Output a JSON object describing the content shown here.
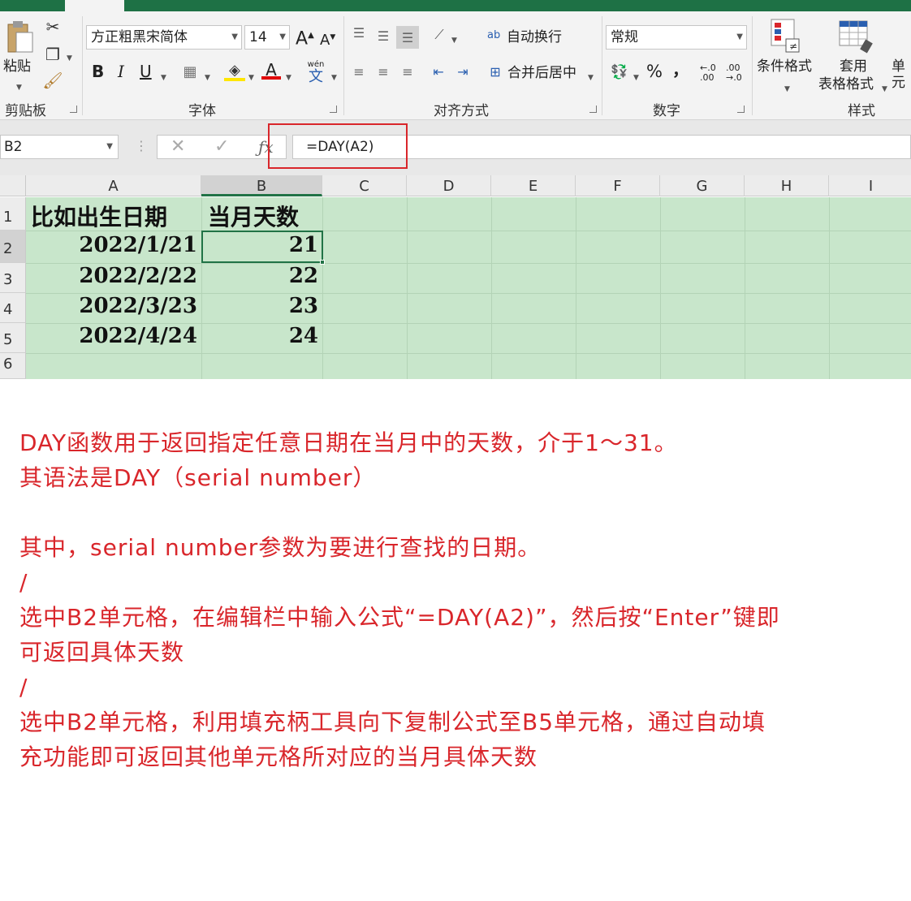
{
  "ribbon": {
    "clipboard": {
      "paste_label": "粘贴",
      "group_label": "剪贴板"
    },
    "font": {
      "font_name": "方正粗黑宋简体",
      "font_size": "14",
      "bold": "B",
      "italic": "I",
      "underline": "U",
      "grow": "A",
      "shrink": "A",
      "font_color": "A",
      "phonetic": "wén",
      "phonetic_char": "文",
      "group_label": "字体"
    },
    "alignment": {
      "wrap_text": "自动换行",
      "merge_center": "合并后居中",
      "wrap_icon_text": "ab",
      "group_label": "对齐方式"
    },
    "number": {
      "format": "常规",
      "percent": "%",
      "comma": "，",
      "inc_decimal": "←.0 .00",
      "dec_decimal": ".00 →.0",
      "group_label": "数字"
    },
    "styles": {
      "conditional": "条件格式",
      "table_format_line1": "套用",
      "table_format_line2": "表格格式",
      "cell_styles": "单元",
      "group_label": "样式"
    }
  },
  "formula_bar": {
    "name_box": "B2",
    "formula": "=DAY(A2)"
  },
  "grid": {
    "columns": [
      "A",
      "B",
      "C",
      "D",
      "E",
      "F",
      "G",
      "H",
      "I"
    ],
    "rows": [
      "1",
      "2",
      "3",
      "4",
      "5",
      "6"
    ],
    "header_a": "比如出生日期",
    "header_b": "当月天数",
    "data": [
      {
        "date": "2022/1/21",
        "day": "21"
      },
      {
        "date": "2022/2/22",
        "day": "22"
      },
      {
        "date": "2022/3/23",
        "day": "23"
      },
      {
        "date": "2022/4/24",
        "day": "24"
      }
    ]
  },
  "notes": {
    "line1": "DAY函数用于返回指定任意日期在当月中的天数，介于1～31。",
    "line2": "其语法是DAY（serial number）",
    "line3": "其中，serial number参数为要进行查找的日期。",
    "line4": "/",
    "line5": "选中B2单元格，在编辑栏中输入公式“=DAY(A2)”，然后按“Enter”键即",
    "line6": "可返回具体天数",
    "line7": "/",
    "line8": "选中B2单元格，利用填充柄工具向下复制公式至B5单元格，通过自动填",
    "line9": "充功能即可返回其他单元格所对应的当月具体天数"
  }
}
